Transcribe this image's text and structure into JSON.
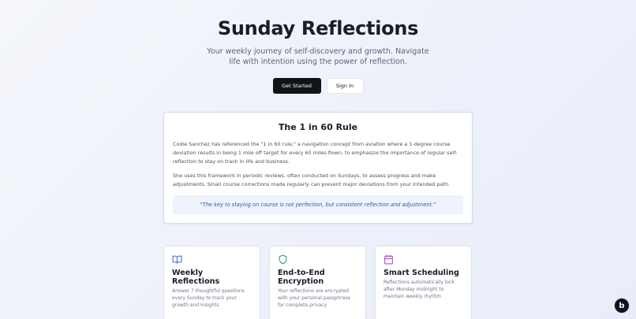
{
  "hero": {
    "title": "Sunday Reflections",
    "subtitle": "Your weekly journey of self-discovery and growth. Navigate life with intention using the power of reflection.",
    "primary_button": "Get Started",
    "secondary_button": "Sign In"
  },
  "rule": {
    "title": "The 1 in 60 Rule",
    "paragraph1": "Codie Sanchez has referenced the \"1 in 60 rule,\" a navigation concept from aviation where a 1-degree course deviation results in being 1 mile off target for every 60 miles flown, to emphasize the importance of regular self-reflection to stay on track in life and business.",
    "paragraph2": "She uses this framework in periodic reviews, often conducted on Sundays, to assess progress and make adjustments. Small course corrections made regularly can prevent major deviations from your intended path.",
    "quote": "\"The key to staying on course is not perfection, but consistent reflection and adjustment.\""
  },
  "features": [
    {
      "icon": "book-open-icon",
      "title": "Weekly Reflections",
      "description": "Answer 7 thoughtful questions every Sunday to track your growth and insights"
    },
    {
      "icon": "shield-icon",
      "title": "End-to-End Encryption",
      "description": "Your reflections are encrypted with your personal passphrase for complete privacy"
    },
    {
      "icon": "calendar-icon",
      "title": "Smart Scheduling",
      "description": "Reflections automatically lock after Monday midnight to maintain weekly rhythm"
    }
  ],
  "badge": {
    "icon": "bolt-b-logo-icon",
    "letter": "b"
  },
  "colors": {
    "primary": "#111318",
    "book_icon": "#4f6fd6",
    "shield_icon": "#2e9e6a",
    "calendar_icon": "#a64fd6",
    "quote_text": "#3756a8"
  }
}
